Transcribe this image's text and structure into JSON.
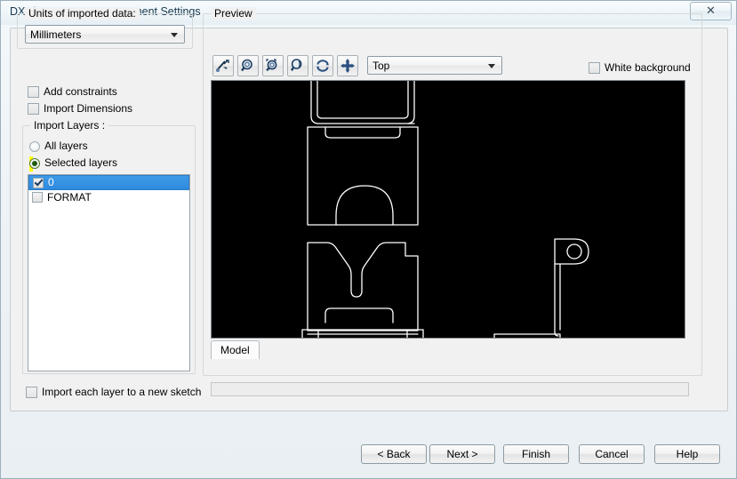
{
  "window": {
    "title": "DXF/DWG Import - Document Settings",
    "close_glyph": "✕"
  },
  "units": {
    "legend": "Units of imported data:",
    "selected": "Millimeters",
    "options": [
      "Millimeters"
    ]
  },
  "options": {
    "add_constraints": {
      "label": "Add constraints",
      "checked": false
    },
    "import_dimensions": {
      "label": "Import Dimensions",
      "checked": false
    },
    "import_each_layer": {
      "label": "Import each layer to a new sketch",
      "checked": false
    }
  },
  "import_layers": {
    "legend": "Import Layers :",
    "radios": [
      {
        "label": "All layers",
        "selected": false,
        "highlighted": false
      },
      {
        "label": "Selected layers",
        "selected": true,
        "highlighted": true
      }
    ],
    "list": [
      {
        "label": "0",
        "checked": true,
        "selected": true
      },
      {
        "label": "FORMAT",
        "checked": false,
        "selected": false
      }
    ]
  },
  "preview": {
    "legend": "Preview",
    "toolbar": [
      {
        "name": "zoom-to-selection-icon",
        "title": "Zoom to selection"
      },
      {
        "name": "zoom-in-icon",
        "title": "Zoom in/out"
      },
      {
        "name": "zoom-to-area-icon",
        "title": "Zoom to area"
      },
      {
        "name": "zoom-to-fit-icon",
        "title": "Zoom to fit"
      },
      {
        "name": "rotate-icon",
        "title": "Rotate view"
      },
      {
        "name": "pan-icon",
        "title": "Pan view"
      }
    ],
    "view": {
      "selected": "Top",
      "options": [
        "Top"
      ]
    },
    "white_background": {
      "label": "White background",
      "checked": false
    },
    "canvas_background": "#000000",
    "geometry_color": "#ffffff",
    "tabs": [
      {
        "label": "Model",
        "active": true
      }
    ]
  },
  "buttons": {
    "back": "< Back",
    "next": "Next >",
    "finish": "Finish",
    "cancel": "Cancel",
    "help": "Help"
  },
  "colors": {
    "highlight_yellow": "#ffff00",
    "selection_blue": "#3d9ae8",
    "dialog_bg": "#f1f1f1"
  }
}
